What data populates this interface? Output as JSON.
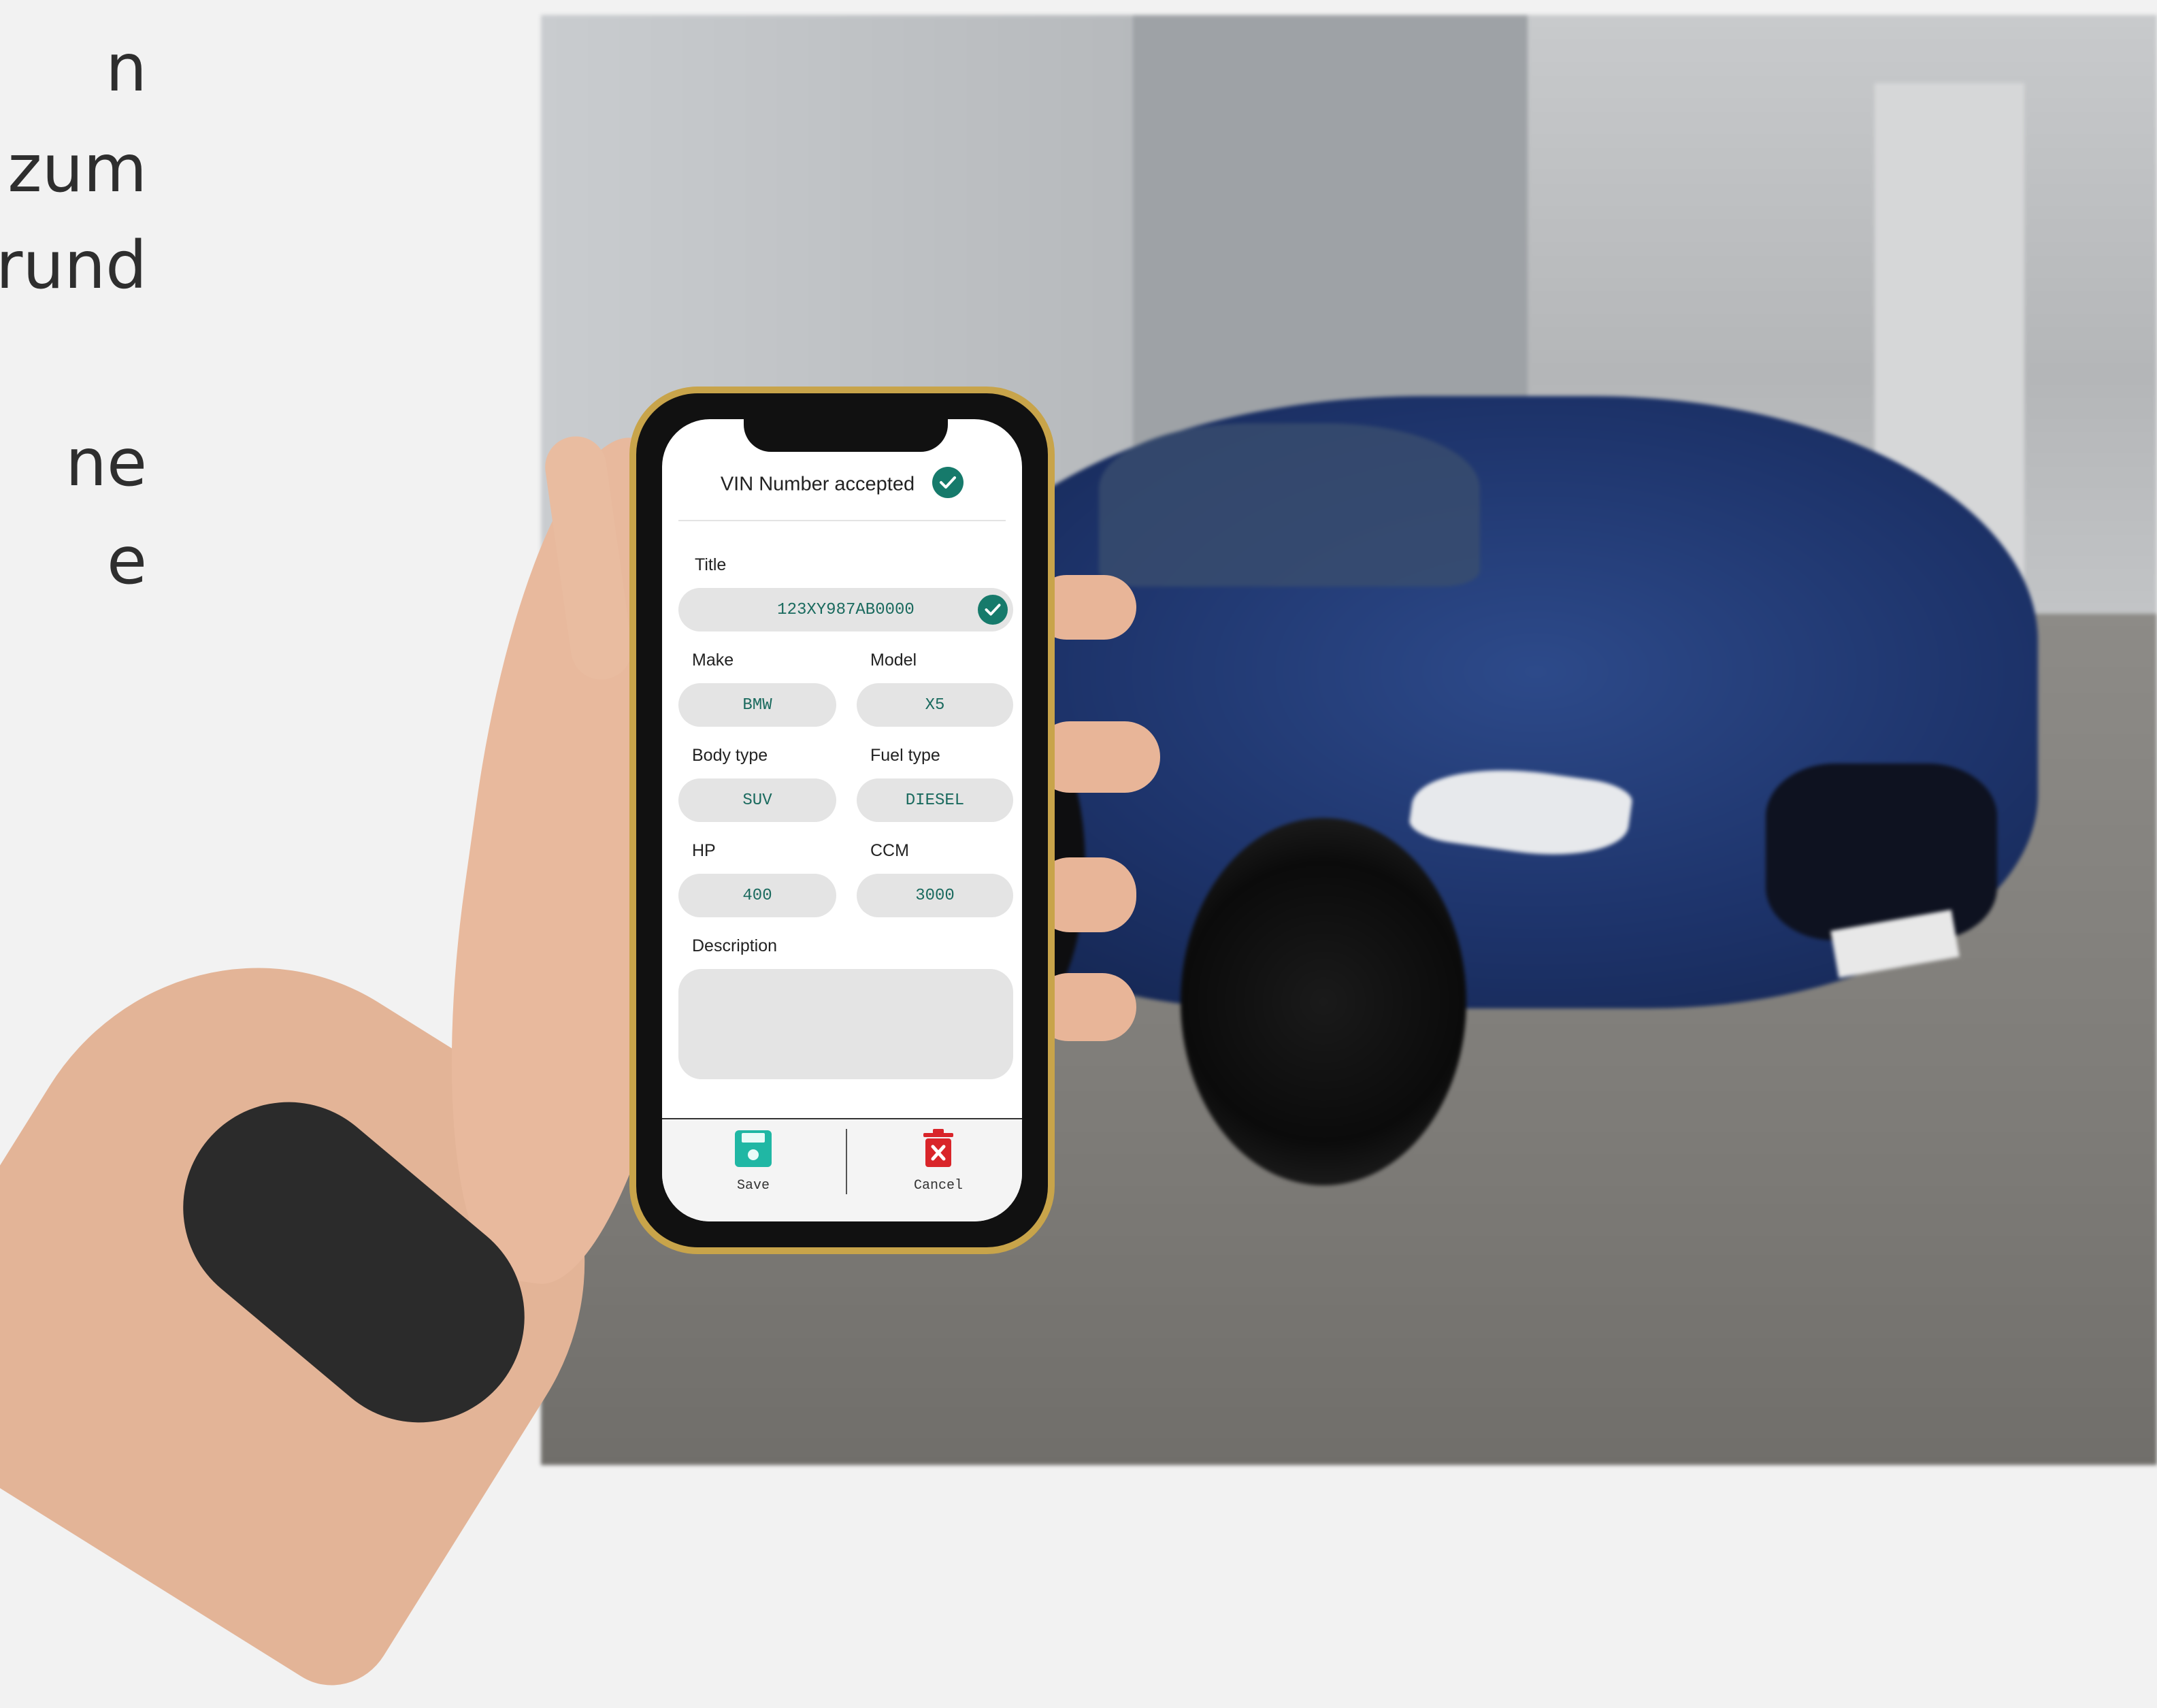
{
  "side_text": [
    "n",
    "zum",
    "rund",
    "ne",
    "e"
  ],
  "app": {
    "status_text": "VIN Number accepted",
    "fields": {
      "title": {
        "label": "Title",
        "value": "123XY987AB0000"
      },
      "make": {
        "label": "Make",
        "value": "BMW"
      },
      "model": {
        "label": "Model",
        "value": "X5"
      },
      "body_type": {
        "label": "Body type",
        "value": "SUV"
      },
      "fuel_type": {
        "label": "Fuel type",
        "value": "DIESEL"
      },
      "hp": {
        "label": "HP",
        "value": "400"
      },
      "ccm": {
        "label": "CCM",
        "value": "3000"
      },
      "description": {
        "label": "Description",
        "value": ""
      }
    },
    "bottom_bar": {
      "save_label": "Save",
      "cancel_label": "Cancel"
    }
  },
  "colors": {
    "accent": "#167a6b",
    "save_icon": "#20b7a4",
    "cancel_icon": "#d9252a",
    "frame": "#c8a44a"
  },
  "icons": [
    "check-icon",
    "save-icon",
    "trash-icon"
  ]
}
